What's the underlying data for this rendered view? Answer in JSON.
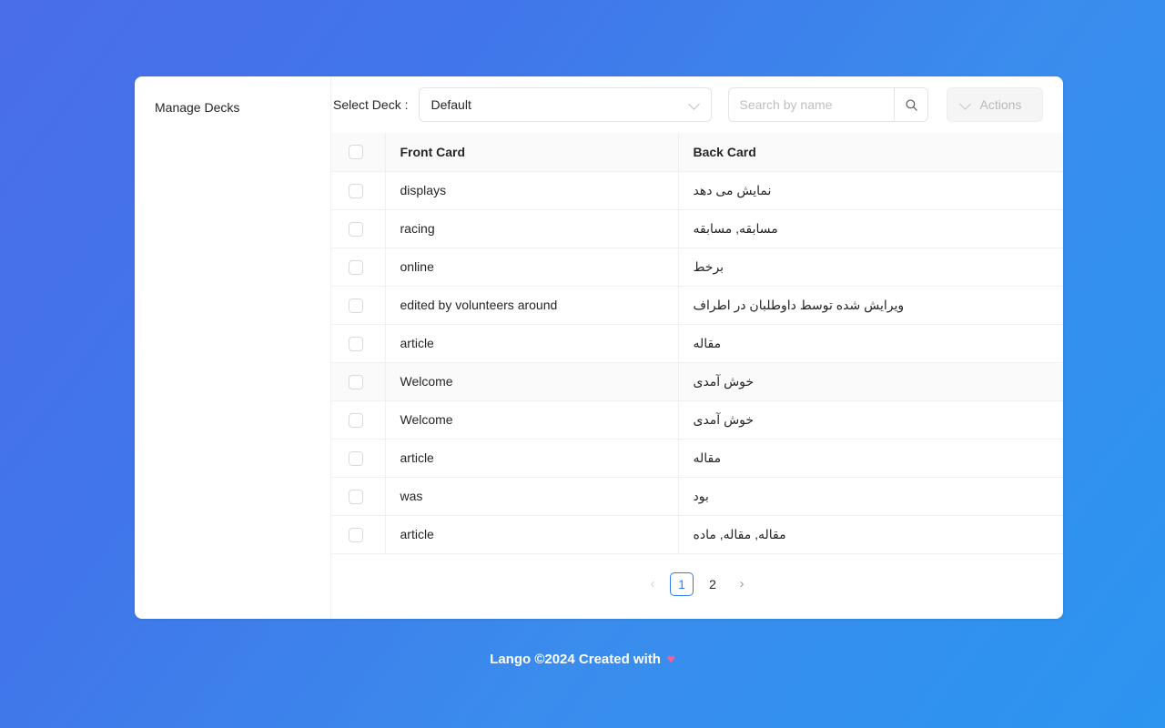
{
  "theme": {
    "background_from": "#4a6ee8",
    "background_to": "#2b95f0",
    "accent": "#2f7bf6",
    "heart_color": "#ff5c93",
    "card_background": "#ffffff",
    "row_stripe": "#fafafa"
  },
  "sidebar": {
    "title": "Manage Decks"
  },
  "toolbar": {
    "select_deck_label": "Select Deck :",
    "deck_select": {
      "name": "deck-select",
      "value": "Default",
      "chevron_icon": "chevron-down-icon"
    },
    "search": {
      "value": "",
      "placeholder": "Search by name",
      "search_icon": "search-icon"
    },
    "actions": {
      "label": "Actions",
      "chevron_icon": "chevron-down-icon",
      "disabled": true
    }
  },
  "table": {
    "columns": [
      {
        "key": "check",
        "label": ""
      },
      {
        "key": "front",
        "label": "Front Card"
      },
      {
        "key": "back",
        "label": "Back Card"
      }
    ],
    "header_checkbox_checked": false,
    "rows": [
      {
        "checked": false,
        "front": "displays",
        "back": "نمایش می دهد"
      },
      {
        "checked": false,
        "front": "racing",
        "back": "مسابقه, مسابقه"
      },
      {
        "checked": false,
        "front": "online",
        "back": "برخط"
      },
      {
        "checked": false,
        "front": "edited by volunteers around",
        "back": "ویرایش شده توسط داوطلبان در اطراف"
      },
      {
        "checked": false,
        "front": "article",
        "back": "مقاله"
      },
      {
        "checked": false,
        "front": "Welcome",
        "back": "خوش آمدی"
      },
      {
        "checked": false,
        "front": "Welcome",
        "back": "خوش آمدی"
      },
      {
        "checked": false,
        "front": "article",
        "back": "مقاله"
      },
      {
        "checked": false,
        "front": "was",
        "back": "بود"
      },
      {
        "checked": false,
        "front": "article",
        "back": "مقاله, مقاله, ماده"
      }
    ],
    "striped_row_index": 5
  },
  "pagination": {
    "prev_icon": "chevron-left-icon",
    "next_icon": "chevron-right-icon",
    "prev_disabled": true,
    "next_disabled": false,
    "pages": [
      "1",
      "2"
    ],
    "current_page": "1"
  },
  "footer": {
    "text": "Lango ©2024 Created with",
    "heart_icon": "heart-icon",
    "heart_glyph": "♥"
  }
}
